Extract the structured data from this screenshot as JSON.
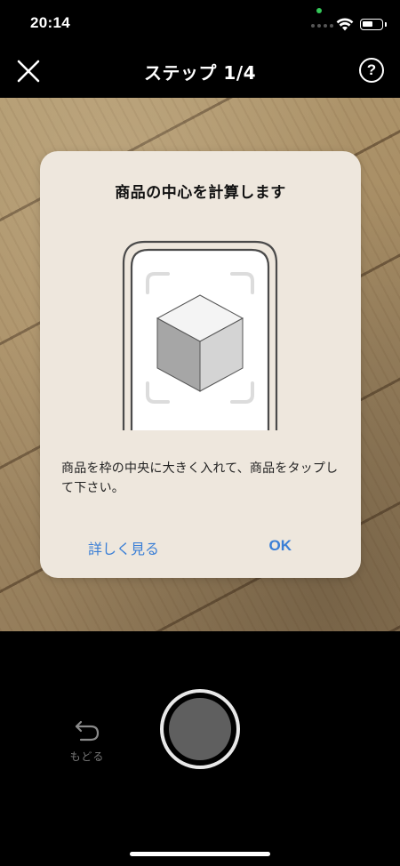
{
  "status_bar": {
    "time": "20:14"
  },
  "nav": {
    "title": "ステップ 1/4",
    "help_glyph": "?"
  },
  "dialog": {
    "title": "商品の中心を計算します",
    "message": "商品を枠の中央に大きく入れて、商品をタップして下さい。",
    "learn_more_label": "詳しく見る",
    "ok_label": "OK"
  },
  "bottom": {
    "back_label": "もどる"
  },
  "icons": {
    "close": "close-icon",
    "help": "question-icon",
    "back": "undo-arrow-icon",
    "illustration": "phone-frame-cube-icon"
  },
  "colors": {
    "accent": "#3b7fd6",
    "dialog_bg": "#eee7dd",
    "background": "#000000",
    "shutter_inner": "#5f5f5f"
  }
}
